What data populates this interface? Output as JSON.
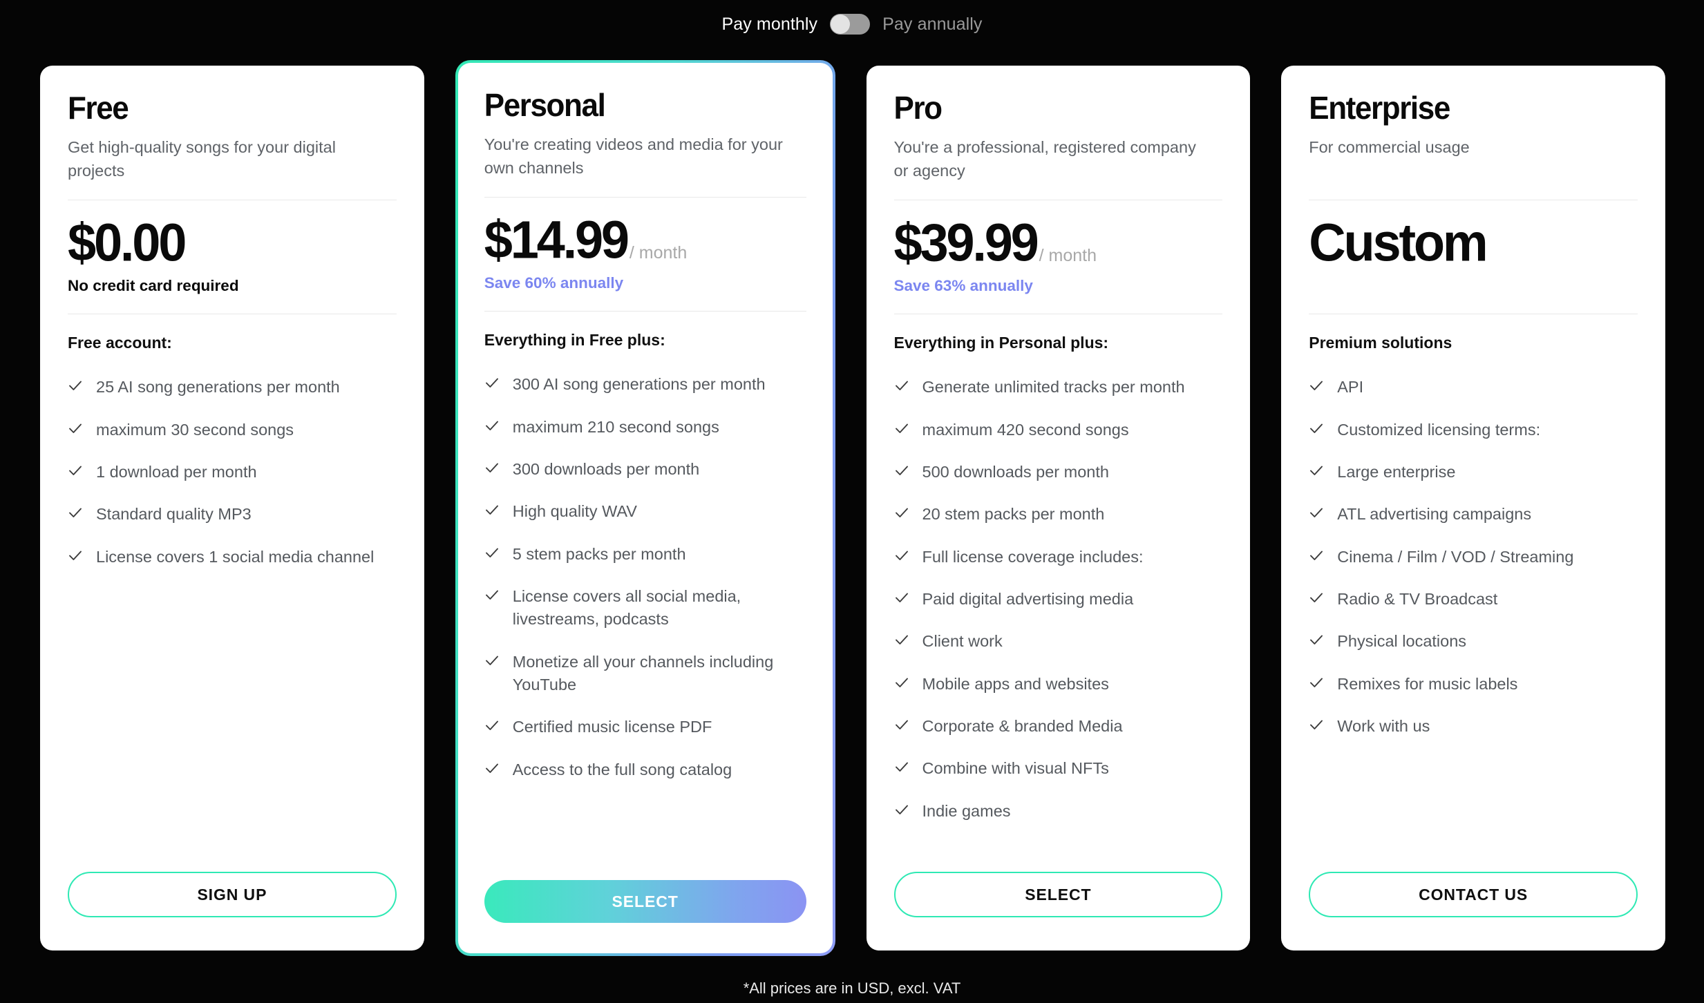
{
  "billing": {
    "monthly_label": "Pay monthly",
    "annual_label": "Pay annually",
    "selected": "monthly",
    "toggle_icon": "toggle-switch-icon"
  },
  "accent_colors": {
    "mint": "#2FE9B4",
    "periwinkle": "#7B86F0",
    "gradient_start": "#3AE9BC",
    "gradient_end": "#8B93F3",
    "page_background": "#050505",
    "card_background": "#FFFFFF"
  },
  "plans": [
    {
      "name": "Free",
      "tagline": "Get high-quality songs for your digital projects",
      "price": "$0.00",
      "period": "",
      "note": "No credit card required",
      "note_type": "plain",
      "features_heading": "Free account:",
      "features": [
        "25 AI song generations per month",
        "maximum 30 second songs",
        "1 download per month",
        "Standard quality MP3",
        "License covers 1 social media channel"
      ],
      "cta_label": "SIGN UP",
      "cta_style": "outline",
      "featured": false
    },
    {
      "name": "Personal",
      "tagline": "You're creating videos and media for your own channels",
      "price": "$14.99",
      "period": "/ month",
      "note": "Save 60% annually",
      "note_type": "save",
      "features_heading": "Everything in Free plus:",
      "features": [
        "300 AI song generations per month",
        "maximum 210 second songs",
        "300 downloads per month",
        "High quality WAV",
        "5 stem packs per month",
        "License covers all social media, livestreams, podcasts",
        "Monetize all your channels including YouTube",
        "Certified music license PDF",
        "Access to the full song catalog"
      ],
      "cta_label": "SELECT",
      "cta_style": "gradient",
      "featured": true
    },
    {
      "name": "Pro",
      "tagline": "You're a professional, registered company or agency",
      "price": "$39.99",
      "period": "/ month",
      "note": "Save 63% annually",
      "note_type": "save",
      "features_heading": "Everything in Personal plus:",
      "features": [
        "Generate unlimited tracks per month",
        "maximum 420 second songs",
        "500 downloads per month",
        "20 stem packs per month",
        "Full license coverage includes:",
        "Paid digital advertising media",
        "Client work",
        "Mobile apps and websites",
        "Corporate & branded Media",
        "Combine with visual NFTs",
        "Indie games"
      ],
      "cta_label": "SELECT",
      "cta_style": "outline",
      "featured": false
    },
    {
      "name": "Enterprise",
      "tagline": "For commercial usage",
      "price": "Custom",
      "period": "",
      "note": "",
      "note_type": "empty",
      "features_heading": "Premium solutions",
      "features": [
        "API",
        "Customized licensing terms:",
        "Large enterprise",
        "ATL advertising campaigns",
        "Cinema / Film / VOD / Streaming",
        "Radio & TV Broadcast",
        "Physical locations",
        "Remixes for music labels",
        "Work with us"
      ],
      "cta_label": "CONTACT US",
      "cta_style": "outline",
      "featured": false
    }
  ],
  "footer": {
    "note": "*All prices are in USD, excl. VAT"
  }
}
